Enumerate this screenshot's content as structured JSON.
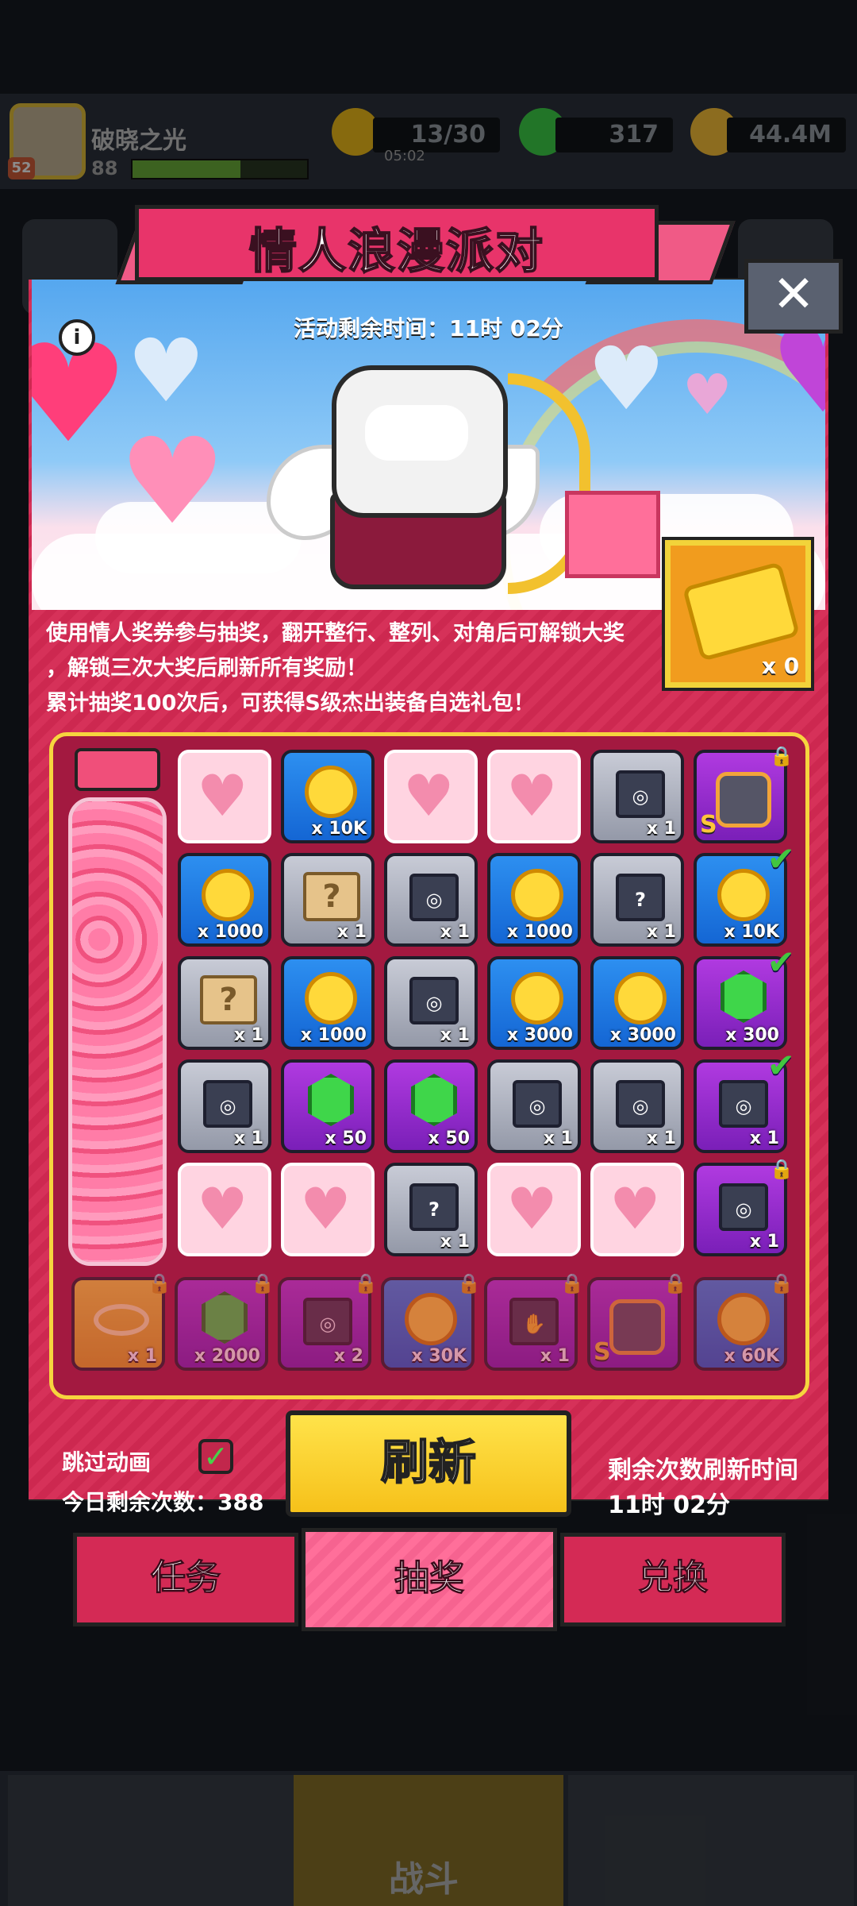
{
  "player": {
    "name": "破晓之光",
    "level": "88",
    "badge": "52"
  },
  "resources": {
    "energy": "13/30",
    "energy_timer": "05:02",
    "gems": "317",
    "coins": "44.4M"
  },
  "event": {
    "title": "情人浪漫派对",
    "timer_text": "活动剩余时间：11时 02分",
    "ticket_count": "x 0",
    "description": [
      "使用情人奖券参与抽奖，翻开整行、整列、对角后可解锁大奖",
      "，解锁三次大奖后刷新所有奖励！",
      "累计抽奖100次后，可获得S级杰出装备自选礼包！"
    ]
  },
  "grid": [
    [
      {
        "type": "pink",
        "icon": "heart-icon",
        "amount": ""
      },
      {
        "type": "blue",
        "icon": "coin-icon",
        "amount": "x 10K"
      },
      {
        "type": "pink",
        "icon": "heart-icon",
        "amount": ""
      },
      {
        "type": "pink",
        "icon": "heart-icon",
        "amount": ""
      },
      {
        "type": "gray",
        "icon": "chest-icon",
        "amount": "x 1"
      },
      {
        "type": "purple",
        "icon": "equipment-icon",
        "amount": "S",
        "locked": true
      }
    ],
    [
      {
        "type": "blue",
        "icon": "coin-icon",
        "amount": "x 1000"
      },
      {
        "type": "gray",
        "icon": "mystery-scroll-icon",
        "amount": "x 1"
      },
      {
        "type": "gray",
        "icon": "chest-icon",
        "amount": "x 1"
      },
      {
        "type": "blue",
        "icon": "coin-icon",
        "amount": "x 1000"
      },
      {
        "type": "gray",
        "icon": "mystery-chest-icon",
        "amount": "x 1"
      },
      {
        "type": "blue",
        "icon": "coin-icon",
        "amount": "x 10K",
        "checked": true
      }
    ],
    [
      {
        "type": "gray",
        "icon": "mystery-scroll-icon",
        "amount": "x 1"
      },
      {
        "type": "blue",
        "icon": "coin-icon",
        "amount": "x 1000"
      },
      {
        "type": "gray",
        "icon": "chest-icon",
        "amount": "x 1"
      },
      {
        "type": "blue",
        "icon": "coin-icon",
        "amount": "x 3000"
      },
      {
        "type": "blue",
        "icon": "coin-icon",
        "amount": "x 3000"
      },
      {
        "type": "purple",
        "icon": "gem-icon",
        "amount": "x 300",
        "checked": true
      }
    ],
    [
      {
        "type": "gray",
        "icon": "chest-icon",
        "amount": "x 1"
      },
      {
        "type": "purple",
        "icon": "gem-icon",
        "amount": "x 50"
      },
      {
        "type": "purple",
        "icon": "gem-icon",
        "amount": "x 50"
      },
      {
        "type": "gray",
        "icon": "chest-icon",
        "amount": "x 1"
      },
      {
        "type": "gray",
        "icon": "chest-icon",
        "amount": "x 1"
      },
      {
        "type": "purple",
        "icon": "chest-icon",
        "amount": "x 1",
        "checked": true
      }
    ],
    [
      {
        "type": "pink",
        "icon": "heart-icon",
        "amount": ""
      },
      {
        "type": "pink",
        "icon": "heart-icon",
        "amount": ""
      },
      {
        "type": "gray",
        "icon": "mystery-chest-icon",
        "amount": "x 1"
      },
      {
        "type": "pink",
        "icon": "heart-icon",
        "amount": ""
      },
      {
        "type": "pink",
        "icon": "heart-icon",
        "amount": ""
      },
      {
        "type": "purple",
        "icon": "chest-icon",
        "amount": "x 1",
        "locked": true
      }
    ]
  ],
  "bonus_row": [
    {
      "type": "gold",
      "icon": "ring-icon",
      "amount": "x 1",
      "locked": true
    },
    {
      "type": "purple",
      "icon": "gem-icon",
      "amount": "x 2000",
      "locked": true
    },
    {
      "type": "purple",
      "icon": "chest-icon",
      "amount": "x 2",
      "locked": true
    },
    {
      "type": "blue",
      "icon": "coin-icon",
      "amount": "x 30K",
      "locked": true
    },
    {
      "type": "purple",
      "icon": "hand-chest-icon",
      "amount": "x 1",
      "locked": true
    },
    {
      "type": "purple",
      "icon": "equipment-icon",
      "amount": "S",
      "locked": true
    },
    {
      "type": "blue",
      "icon": "coin-icon",
      "amount": "x 60K",
      "locked": true
    }
  ],
  "controls": {
    "skip_animation": "跳过动画",
    "remaining_today": "今日剩余次数：388",
    "refresh": "刷新",
    "refresh_time_label": "剩余次数刷新时间",
    "refresh_time": "11时 02分"
  },
  "tabs": [
    "任务",
    "抽奖",
    "兑换"
  ],
  "bottom_nav": {
    "fight": "战斗"
  }
}
